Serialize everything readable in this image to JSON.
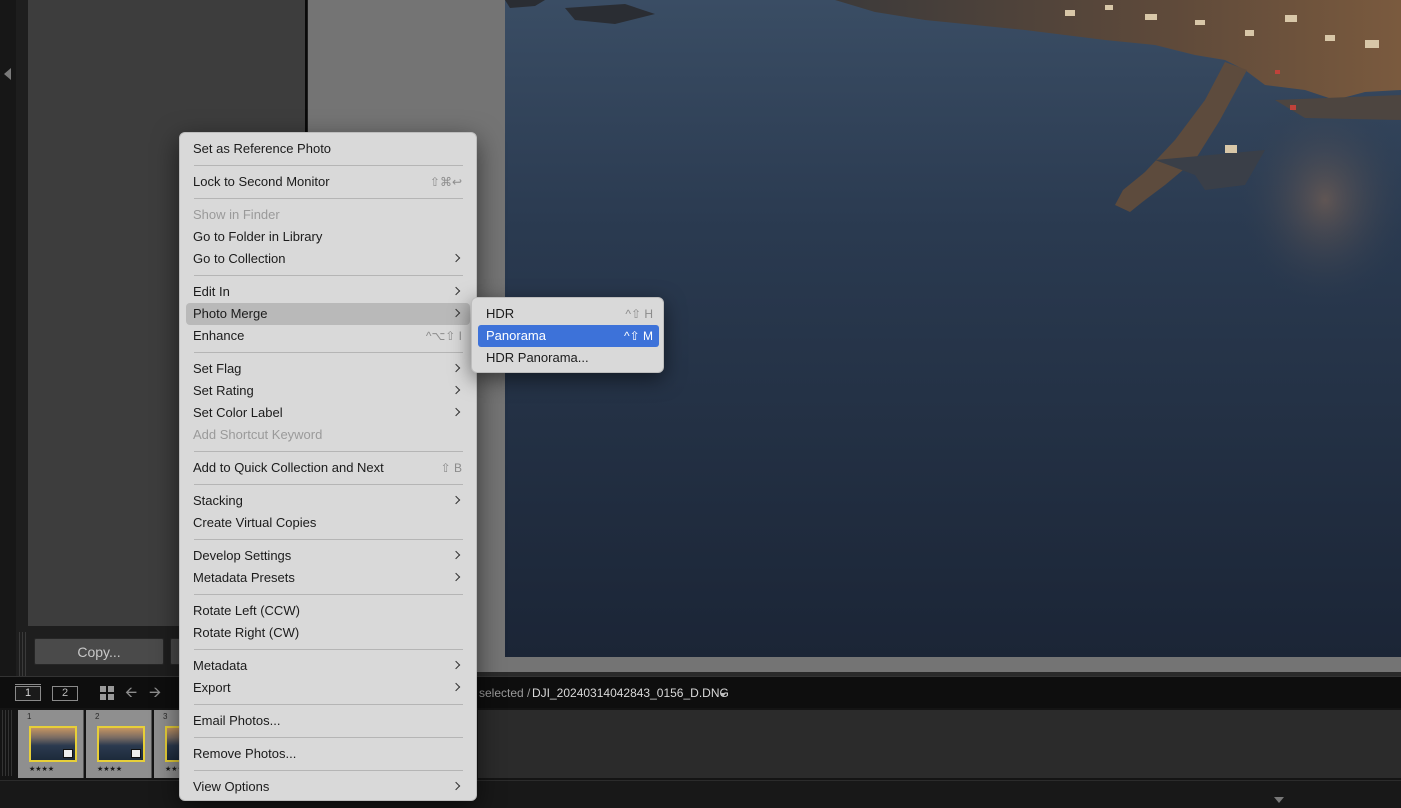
{
  "panel": {
    "copy_label": "Copy..."
  },
  "toolbar": {
    "monitor_1": "1",
    "monitor_2": "2",
    "selection_prefix": "selected /",
    "selection_filename": "DJI_20240314042843_0156_D.DNG"
  },
  "filmstrip": {
    "items": [
      {
        "number": "1",
        "stars": "★★★★"
      },
      {
        "number": "2",
        "stars": "★★★★"
      },
      {
        "number": "3",
        "stars": "★★★"
      }
    ],
    "selection_color": "#e7cf38"
  },
  "context_menu": {
    "items": [
      {
        "label": "Set as Reference Photo"
      },
      {
        "label": "Lock to Second Monitor",
        "shortcut": "⇧⌘↩"
      },
      {
        "label": "Show in Finder",
        "disabled": true
      },
      {
        "label": "Go to Folder in Library"
      },
      {
        "label": "Go to Collection",
        "submenu": true
      },
      {
        "label": "Edit In",
        "submenu": true
      },
      {
        "label": "Photo Merge",
        "submenu": true,
        "highlighted": true
      },
      {
        "label": "Enhance",
        "shortcut": "^⌥⇧ I"
      },
      {
        "label": "Set Flag",
        "submenu": true
      },
      {
        "label": "Set Rating",
        "submenu": true
      },
      {
        "label": "Set Color Label",
        "submenu": true
      },
      {
        "label": "Add Shortcut Keyword",
        "disabled": true
      },
      {
        "label": "Add to Quick Collection and Next",
        "shortcut": "⇧ B"
      },
      {
        "label": "Stacking",
        "submenu": true
      },
      {
        "label": "Create Virtual Copies"
      },
      {
        "label": "Develop Settings",
        "submenu": true
      },
      {
        "label": "Metadata Presets",
        "submenu": true
      },
      {
        "label": "Rotate Left (CCW)"
      },
      {
        "label": "Rotate Right (CW)"
      },
      {
        "label": "Metadata",
        "submenu": true
      },
      {
        "label": "Export",
        "submenu": true
      },
      {
        "label": "Email Photos..."
      },
      {
        "label": "Remove Photos..."
      },
      {
        "label": "View Options",
        "submenu": true
      }
    ]
  },
  "photo_merge_submenu": {
    "items": [
      {
        "label": "HDR",
        "shortcut": "^⇧ H"
      },
      {
        "label": "Panorama",
        "shortcut": "^⇧ M",
        "selected": true
      },
      {
        "label": "HDR Panorama..."
      }
    ],
    "highlight_color": "#3d72d9"
  }
}
